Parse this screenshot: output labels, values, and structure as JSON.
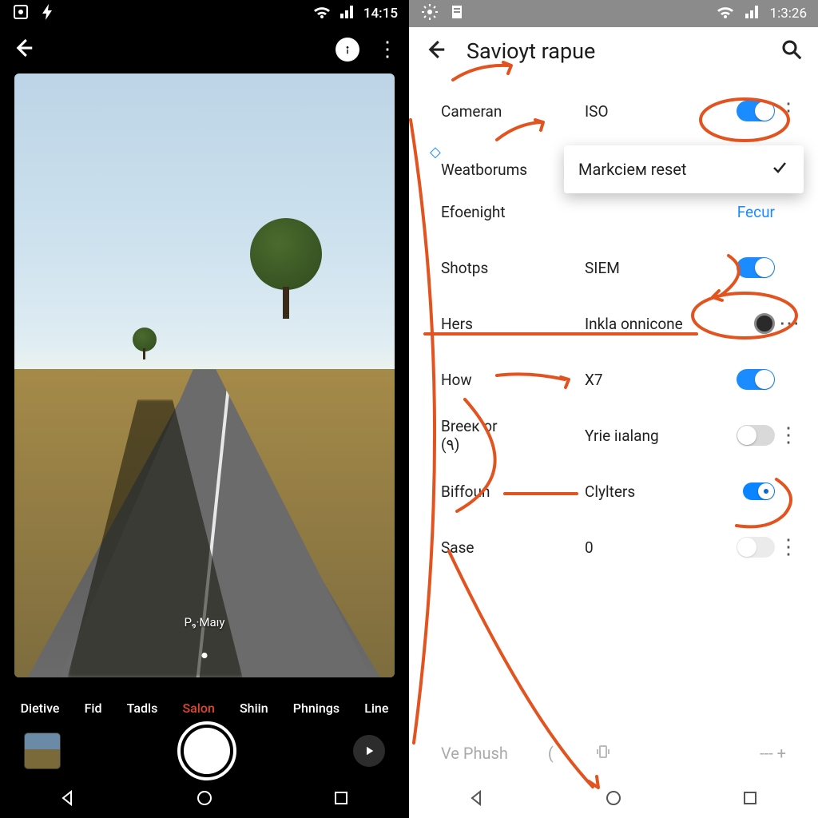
{
  "left": {
    "status_time": "14:15",
    "viewfinder_caption": "P₉·Maıy",
    "modes": [
      "Dietive",
      "Fid",
      "Tadls",
      "Salon",
      "Shiin",
      "Phnings",
      "Line"
    ],
    "active_mode_index": 3
  },
  "right": {
    "status_time": "1:3:26",
    "title": "Savioyt rapue",
    "dropdown_label": "Markcieм reset",
    "rows": [
      {
        "k": "Cameran",
        "v": "ISO",
        "ctl": "toggle-on",
        "menu": "v"
      },
      {
        "k": "Weatborums",
        "v": "",
        "ctl": "",
        "menu": ""
      },
      {
        "k": "Efoenight",
        "v": "",
        "ctl": "link",
        "link_text": "Fecur",
        "menu": ""
      },
      {
        "k": "Shotps",
        "v": "SIEM",
        "ctl": "toggle-on",
        "menu": ""
      },
      {
        "k": "Hers",
        "v": "Inkla onnicone",
        "ctl": "radio-dark",
        "menu": "h"
      },
      {
        "k": "How",
        "v": "X7",
        "ctl": "toggle-on",
        "menu": ""
      },
      {
        "k": "Breeк or\n(٩)",
        "v": "Yrie iıalang",
        "ctl": "toggle-off",
        "menu": "v"
      },
      {
        "k": "Biffoun",
        "v": "Clylters",
        "ctl": "toggle-dot-on",
        "menu": ""
      },
      {
        "k": "Sase",
        "v": "0",
        "ctl": "toggle-off-faint",
        "menu": "v"
      }
    ],
    "footer_label": "Ve Phush",
    "footer_paren": "(",
    "footer_trail": "--- +"
  },
  "icons": {
    "weather_badge": "◇"
  }
}
